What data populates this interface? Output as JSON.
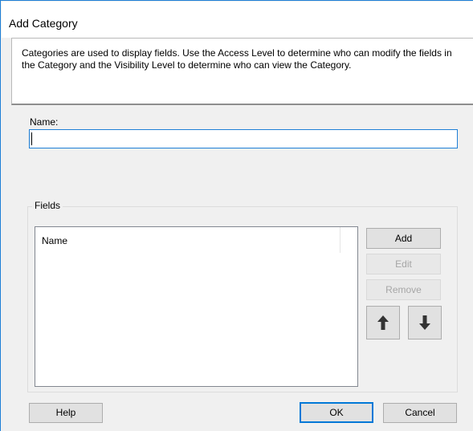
{
  "window": {
    "title": "Add Category"
  },
  "description": "Categories are used to display fields.  Use the Access Level to determine who can modify the fields in the Category and the Visibility Level to determine who can view the Category.",
  "name_field": {
    "label": "Name:",
    "value": ""
  },
  "fields_group": {
    "legend": "Fields",
    "columns": [
      "Name"
    ],
    "rows": []
  },
  "side_buttons": {
    "add": "Add",
    "edit": "Edit",
    "remove": "Remove",
    "move_up_icon": "up-arrow-icon",
    "move_down_icon": "down-arrow-icon"
  },
  "footer_buttons": {
    "help": "Help",
    "ok": "OK",
    "cancel": "Cancel"
  },
  "colors": {
    "accent": "#0078d7",
    "disabled_text": "#a6a6a6"
  }
}
